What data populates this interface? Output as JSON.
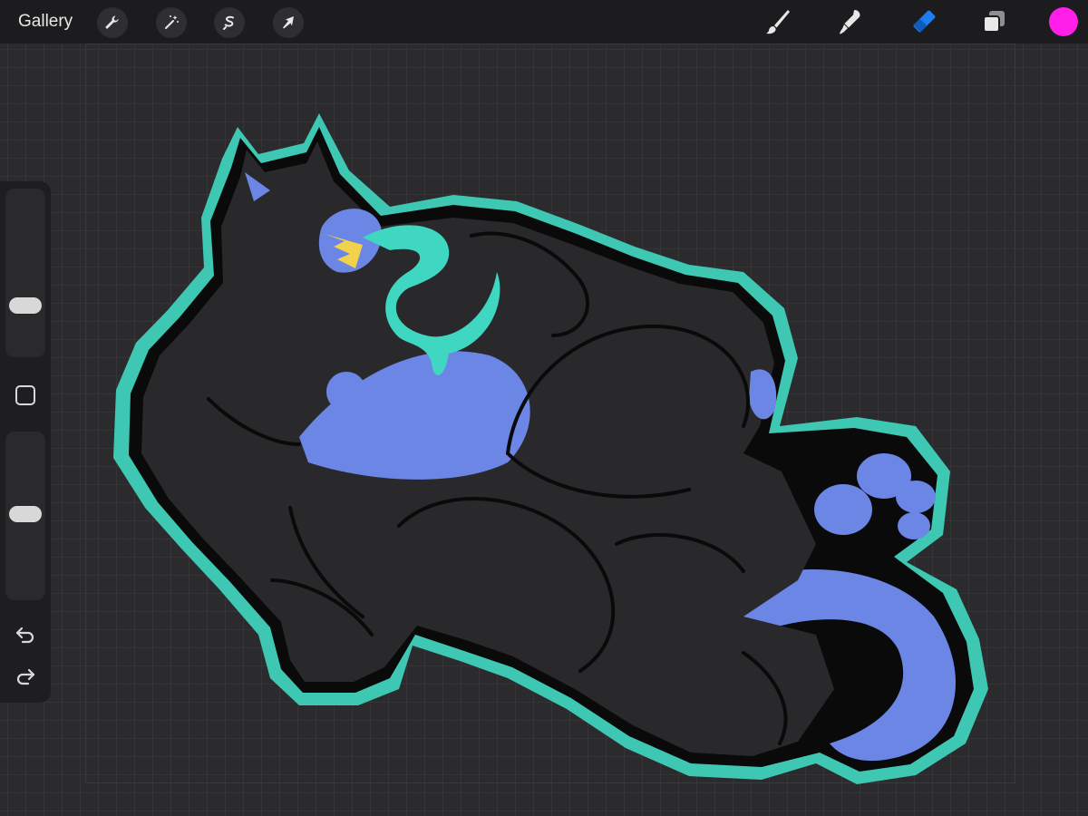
{
  "toolbar": {
    "gallery_label": "Gallery",
    "left_tools": [
      "wrench-icon",
      "magic-wand-icon",
      "selection-icon",
      "transform-icon"
    ],
    "right_tools": [
      "brush-icon",
      "smudge-icon",
      "eraser-icon",
      "layers-icon"
    ],
    "active_tool": "eraser-icon",
    "active_tool_color": "#1c7cf5",
    "current_color": "#ff1fe8"
  },
  "sidebar": {
    "size_slider_level": 0.65,
    "opacity_slider_level": 0.5,
    "icons": [
      "modifier-square-icon",
      "undo-icon",
      "redo-icon"
    ]
  },
  "canvas": {
    "palette": {
      "outline_glow": "#3ec8b4",
      "fur": "#262628",
      "skin": "#6c86e6",
      "drool": "#3fd6c2",
      "teeth": "#f1d24a"
    }
  }
}
